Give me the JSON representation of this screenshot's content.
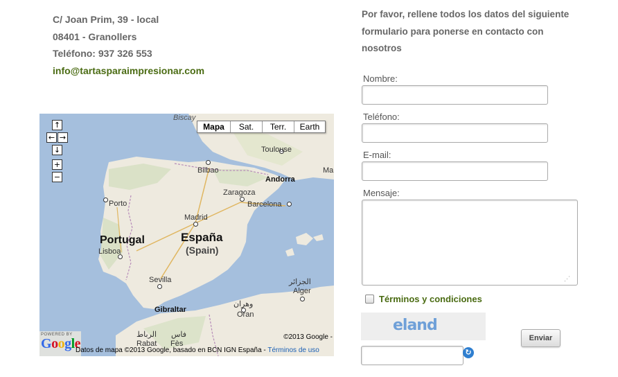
{
  "address": {
    "street": "C/ Joan Prim, 39 - local",
    "city": "08401 - Granollers",
    "phone": "Teléfono: 937 326 553",
    "email": "info@tartasparaimpresionar.com"
  },
  "map": {
    "type_buttons": [
      "Mapa",
      "Sat.",
      "Terr.",
      "Earth"
    ],
    "controls": {
      "up": "↑",
      "left": "←",
      "right": "→",
      "down": "↓",
      "zoom_in": "+",
      "zoom_out": "−"
    },
    "labels": {
      "biscay": "Biscay",
      "bilbao": "Bilbao",
      "toulouse": "Toulouse",
      "andorra": "Andorra",
      "zaragoza": "Zaragoza",
      "porto": "Porto",
      "barcelona": "Barcelona",
      "madrid": "Madrid",
      "portugal": "Portugal",
      "espana": "España",
      "spain": "(Spain)",
      "lisboa": "Lisboa",
      "sevilla": "Sevilla",
      "algiers_ar": "الجزائر",
      "alger": "Alger",
      "oran_ar": "وهران",
      "oran": "Oran",
      "gibraltar": "Gibraltar",
      "rabat_ar": "الرباط",
      "rabat": "Rabat",
      "fes_ar": "فاس",
      "fes": "Fès",
      "ma": "Ma"
    },
    "powered_by": "POWERED BY",
    "google": "Google",
    "copyright": "©2013 Google -",
    "attribution": "Datos de mapa ©2013 Google, basado en BCN IGN España - ",
    "terms_link": "Términos de uso"
  },
  "form": {
    "intro": "Por favor, rellene todos los datos del siguiente formulario para ponerse en contacto con nosotros",
    "name_label": "Nombre:",
    "phone_label": "Teléfono:",
    "email_label": "E-mail:",
    "message_label": "Mensaje:",
    "terms_label": "Términos y condiciones",
    "captcha_text": "eland",
    "submit_label": "Enviar",
    "resize_grip": "⋰"
  },
  "colors": {
    "accent_green": "#4a6b12",
    "text_gray": "#666666",
    "sea": "#a5bfdd",
    "land": "#eeeadf"
  }
}
